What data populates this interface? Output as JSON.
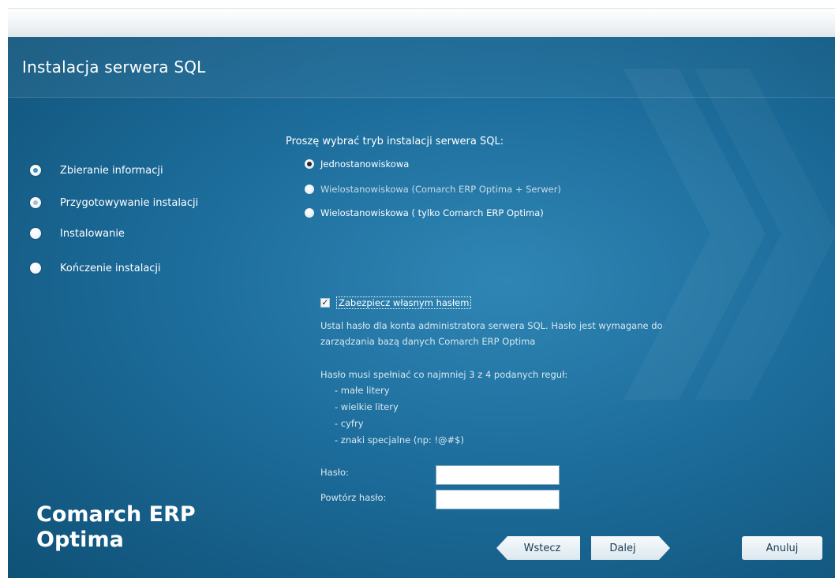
{
  "window": {
    "title": "Instalacja serwera SQL"
  },
  "steps": [
    {
      "label": "Zbieranie informacji",
      "state": "current"
    },
    {
      "label": "Przygotowywanie instalacji",
      "state": "done"
    },
    {
      "label": "Instalowanie",
      "state": "pending"
    },
    {
      "label": "Kończenie instalacji",
      "state": "pending"
    }
  ],
  "install_mode": {
    "prompt": "Proszę wybrać tryb instalacji serwera SQL:",
    "options": [
      {
        "label": "Jednostanowiskowa",
        "selected": true
      },
      {
        "label": "Wielostanowiskowa (Comarch ERP Optima + Serwer)",
        "selected": false
      },
      {
        "label": "Wielostanowiskowa ( tylko Comarch ERP Optima)",
        "selected": false
      }
    ]
  },
  "password_section": {
    "checkbox_label": "Zabezpiecz własnym hasłem",
    "checkbox_checked": true,
    "checkbox_mark": "✓",
    "info_line1": "Ustal hasło dla konta administratora serwera SQL. Hasło jest wymagane do",
    "info_line2": "zarządzania bazą danych Comarch ERP Optima",
    "rules_intro": "Hasło musi spełniać co najmniej 3 z 4 podanych reguł:",
    "rules": [
      "- małe litery",
      "- wielkie litery",
      "- cyfry",
      "- znaki specjalne (np: !@#$)"
    ],
    "password_label": "Hasło:",
    "password_value": "",
    "repeat_label": "Powtórz hasło:",
    "repeat_value": ""
  },
  "brand": {
    "line1": "Comarch ERP",
    "line2": "Optima"
  },
  "buttons": {
    "back": "Wstecz",
    "next": "Dalej",
    "cancel": "Anuluj"
  },
  "colors": {
    "background": "#1d6d9c",
    "text": "#ffffff",
    "button": "#dce8ef"
  }
}
